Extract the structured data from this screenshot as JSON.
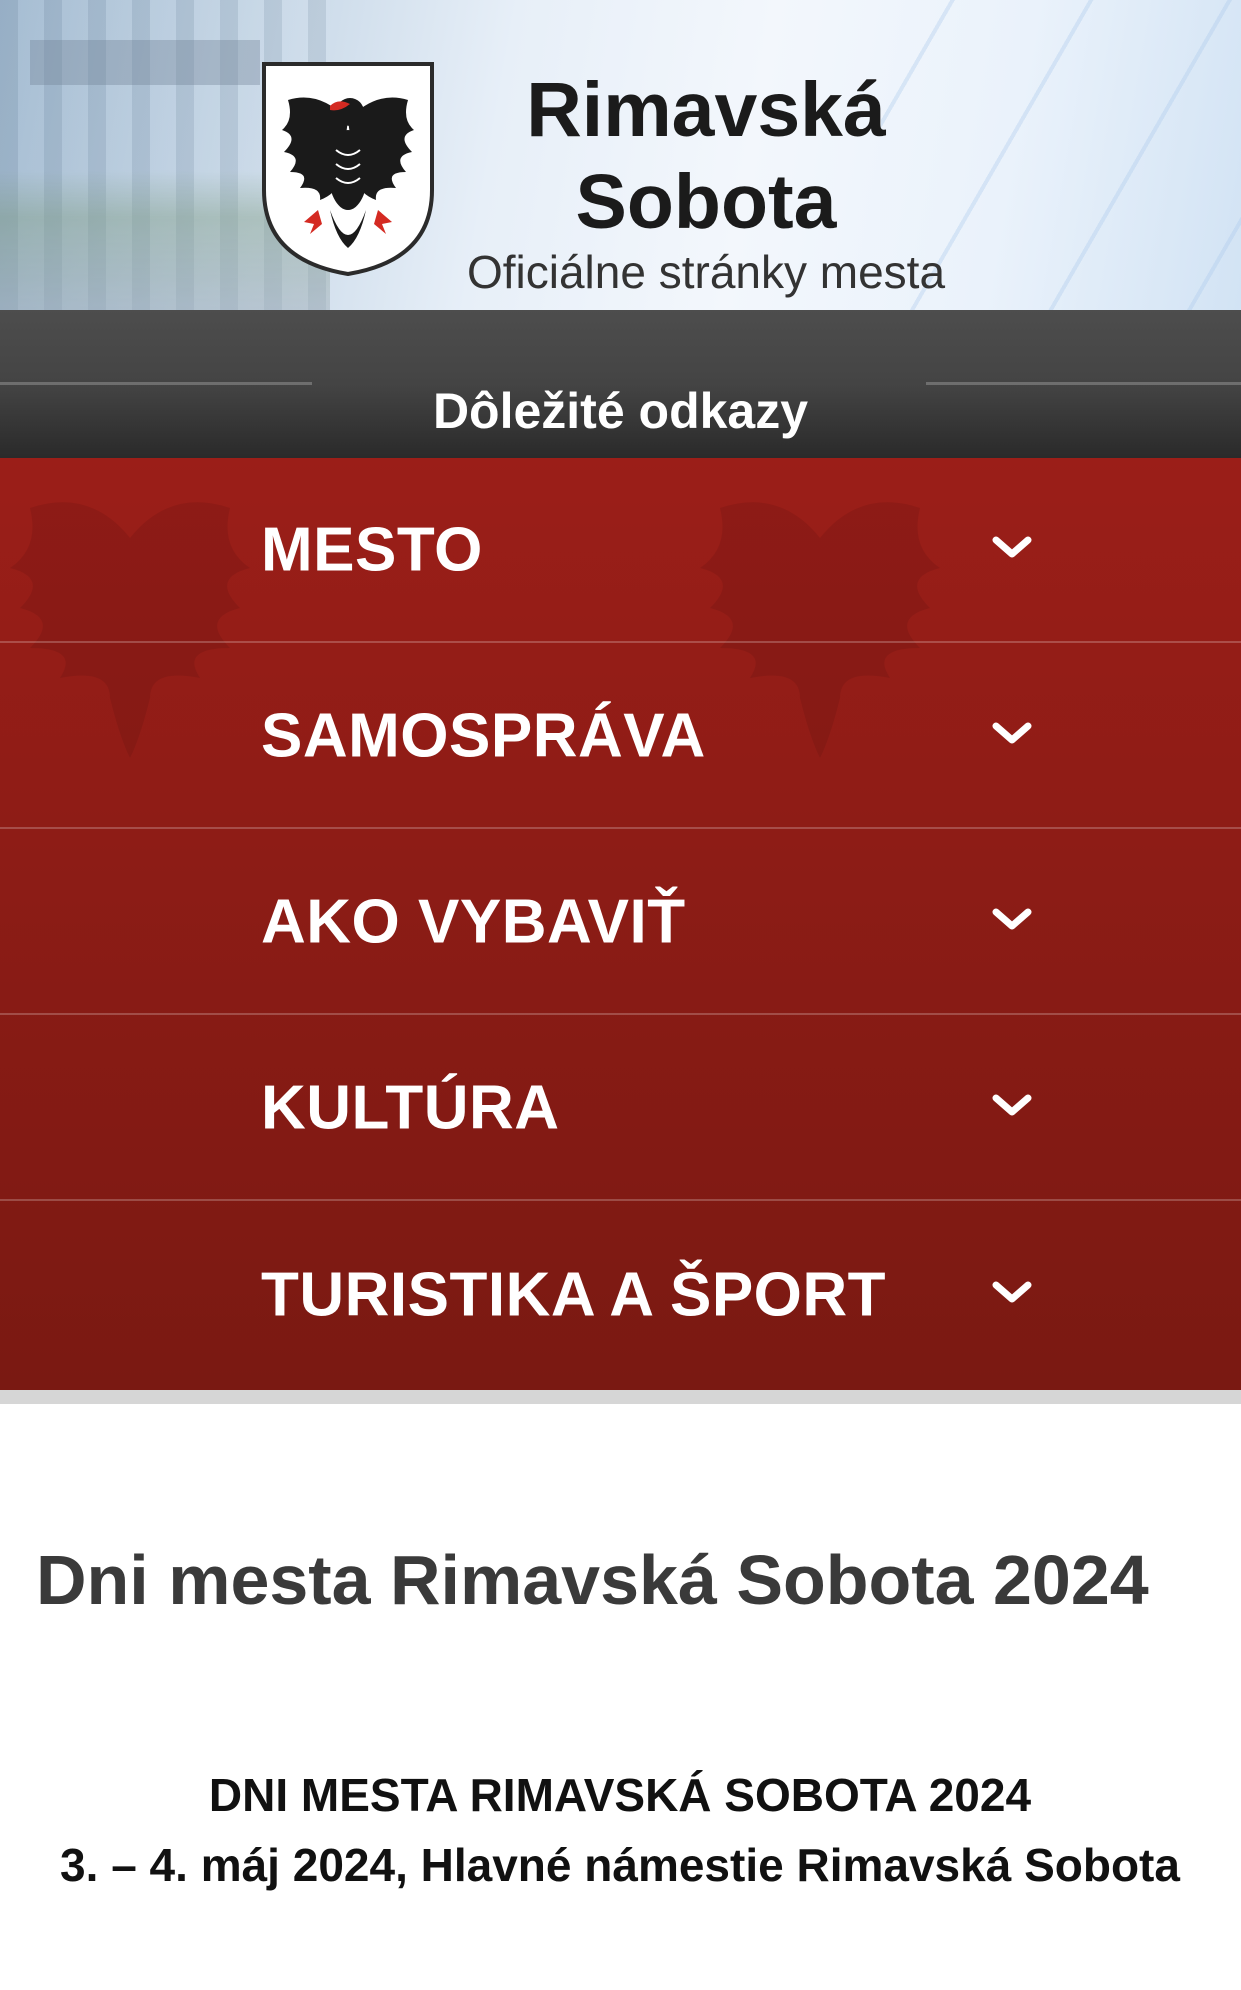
{
  "header": {
    "site_name_line1": "Rimavská",
    "site_name_line2": "Sobota",
    "tagline": "Oficiálne stránky mesta"
  },
  "links_bar": {
    "title": "Dôležité odkazy"
  },
  "nav": {
    "items": [
      {
        "label": "MESTO"
      },
      {
        "label": "SAMOSPRÁVA"
      },
      {
        "label": "AKO VYBAVIŤ"
      },
      {
        "label": "KULTÚRA"
      },
      {
        "label": "TURISTIKA A ŠPORT"
      }
    ]
  },
  "article": {
    "title": "Dni mesta Rimavská Sobota 2024",
    "subtitle_line1": "DNI MESTA RIMAVSKÁ SOBOTA 2024",
    "subtitle_line2": "3. – 4. máj 2024, Hlavné námestie Rimavská Sobota"
  },
  "colors": {
    "nav_red": "#9b1e18",
    "bar_gray": "#444444",
    "title_gray": "#3a3a3a"
  },
  "icons": {
    "crest": "coat-of-arms-eagle-icon",
    "expand": "chevron-down-icon"
  }
}
